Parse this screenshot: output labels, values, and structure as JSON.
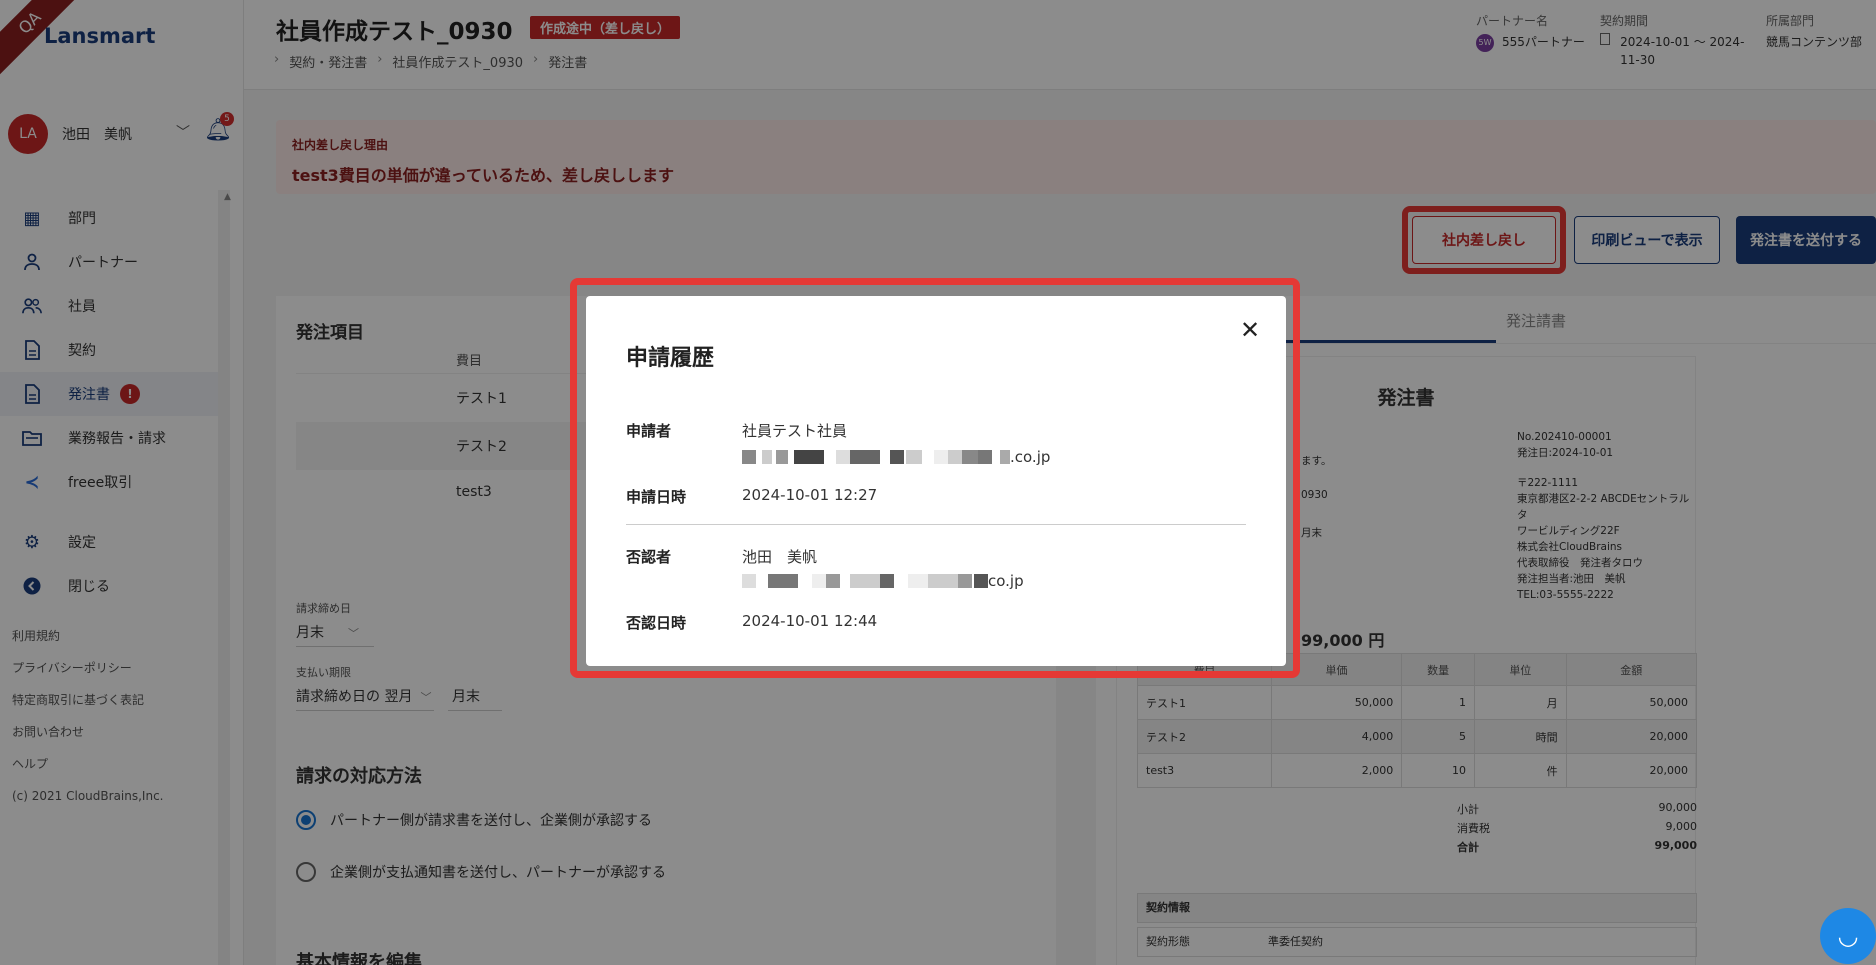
{
  "sidebar": {
    "qa_label": "QA",
    "logo": "Lansmart",
    "user": {
      "initials": "LA",
      "name": "池田　美帆"
    },
    "notif_count": "5",
    "nav": [
      {
        "label": "部門"
      },
      {
        "label": "パートナー"
      },
      {
        "label": "社員"
      },
      {
        "label": "契約"
      },
      {
        "label": "発注書",
        "badge": "!"
      },
      {
        "label": "業務報告・請求"
      },
      {
        "label": "freee取引"
      },
      {
        "label": "設定"
      },
      {
        "label": "閉じる"
      }
    ],
    "footer": [
      "利用規約",
      "プライバシーポリシー",
      "特定商取引に基づく表記",
      "お問い合わせ",
      "ヘルプ",
      "(c) 2021 CloudBrains,Inc."
    ]
  },
  "header": {
    "title": "社員作成テスト_0930",
    "status": "作成途中（差し戻し）",
    "breadcrumb": [
      "契約・発注書",
      "社員作成テスト_0930",
      "発注書"
    ],
    "partner_label": "パートナー名",
    "partner_avatar": "5W",
    "partner": "555パートナー",
    "period_label": "契約期間",
    "period": "2024-10-01 〜 2024-11-30",
    "dept_label": "所属部門",
    "dept": "競馬コンテンツ部"
  },
  "alert": {
    "title": "社内差し戻し理由",
    "text": "test3費目の単価が違っているため、差し戻しします"
  },
  "actions": {
    "reject": "社内差し戻し",
    "print": "印刷ビューで表示",
    "send": "発注書を送付する"
  },
  "order": {
    "title": "発注項目",
    "col": "費目",
    "rows": [
      "テスト1",
      "テスト2",
      "test3"
    ],
    "closing_label": "請求締め日",
    "closing": "月末",
    "due_label": "支払い期限",
    "due": "請求締め日の 翌月",
    "due_day": "月末",
    "method_title": "請求の対応方法",
    "method_1": "パートナー側が請求書を送付し、企業側が承認する",
    "method_2": "企業側が支払通知書を送付し、パートナーが承認する",
    "basic_title": "基本情報を編集"
  },
  "preview": {
    "tab": "発注請書",
    "doc_title": "発注書",
    "no": "No.202410-00001",
    "date": "発注日:2024-10-01",
    "addr": [
      "〒222-1111",
      "東京都港区2-2-2 ABCDEセントラルタ",
      "ワービルディング22F",
      "株式会社CloudBrains",
      "代表取締役　発注者タロウ",
      "発注担当者:池田　美帆",
      "TEL:03-5555-2222"
    ],
    "frag_1": "ます。",
    "frag_2": "0930",
    "frag_3": "月末",
    "total": "99,000 円",
    "headers": [
      "費目",
      "単価",
      "数量",
      "単位",
      "金額"
    ],
    "items": [
      {
        "name": "テスト1",
        "price": "50,000",
        "qty": "1",
        "unit": "月",
        "amount": "50,000"
      },
      {
        "name": "テスト2",
        "price": "4,000",
        "qty": "5",
        "unit": "時間",
        "amount": "20,000"
      },
      {
        "name": "test3",
        "price": "2,000",
        "qty": "10",
        "unit": "件",
        "amount": "20,000"
      }
    ],
    "subtotal_label": "小計",
    "subtotal": "90,000",
    "tax_label": "消費税",
    "tax": "9,000",
    "grand_label": "合計",
    "grand": "99,000",
    "contract_head": "契約情報",
    "contract_type_label": "契約形態",
    "contract_type": "準委任契約"
  },
  "modal": {
    "title": "申請履歴",
    "applicant_label": "申請者",
    "applicant": "社員テスト社員",
    "applicant_email_tail": ".co.jp",
    "applied_label": "申請日時",
    "applied": "2024-10-01 12:27",
    "rejecter_label": "否認者",
    "rejecter": "池田　美帆",
    "rejecter_email_tail": "co.jp",
    "rejected_label": "否認日時",
    "rejected": "2024-10-01 12:44"
  }
}
